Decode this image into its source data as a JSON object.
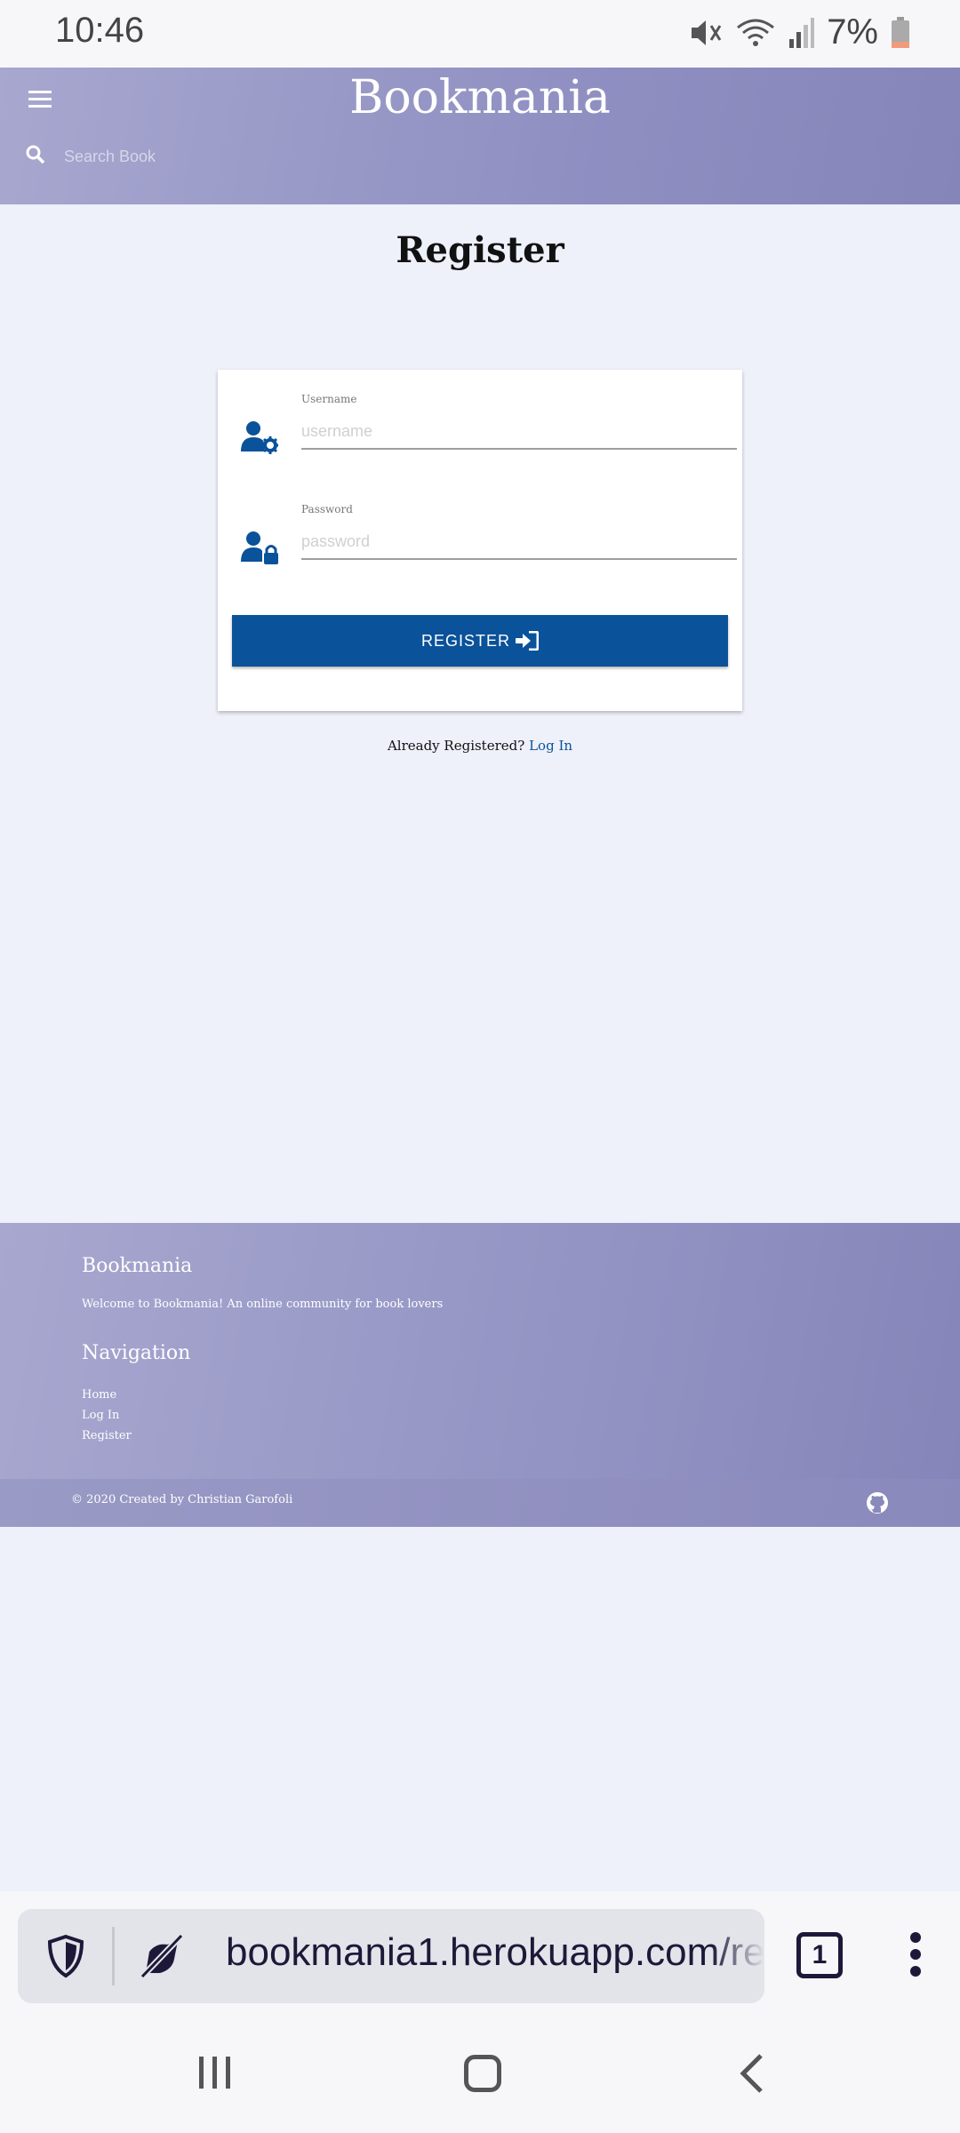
{
  "status_bar": {
    "time": "10:46",
    "battery": "7%"
  },
  "header": {
    "brand": "Bookmania",
    "search_placeholder": "Search Book"
  },
  "main": {
    "title": "Register",
    "username": {
      "label": "Username",
      "placeholder": "username"
    },
    "password": {
      "label": "Password",
      "placeholder": "password"
    },
    "register_button": "REGISTER",
    "already_text": "Already Registered?",
    "login_link": "Log In"
  },
  "footer": {
    "brand": "Bookmania",
    "welcome": "Welcome to Bookmania! An online community for book lovers",
    "nav_title": "Navigation",
    "links": [
      "Home",
      "Log In",
      "Register"
    ],
    "copyright": "© 2020 Created by Christian Garofoli"
  },
  "browser": {
    "url": "bookmania1.herokuapp.com/re",
    "tab_count": "1"
  },
  "colors": {
    "header": "#9a9ac8",
    "accent": "#0a5299",
    "background": "#eef0fa"
  }
}
